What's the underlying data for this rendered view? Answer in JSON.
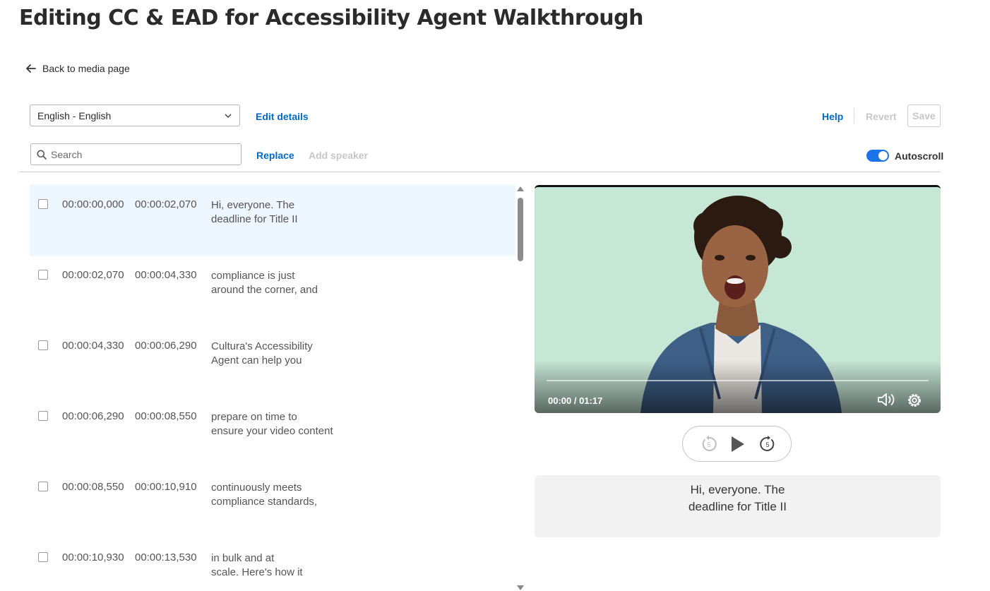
{
  "page": {
    "title": "Editing CC & EAD for Accessibility Agent Walkthrough"
  },
  "nav": {
    "back_label": "Back to media page"
  },
  "toolbar": {
    "language_selected": "English - English",
    "edit_details_label": "Edit details",
    "help_label": "Help",
    "revert_label": "Revert",
    "save_label": "Save",
    "search_placeholder": "Search",
    "replace_label": "Replace",
    "add_speaker_label": "Add speaker",
    "autoscroll_label": "Autoscroll",
    "autoscroll_on": true
  },
  "captions": [
    {
      "start": "00:00:00,000",
      "end": "00:00:02,070",
      "line1": "Hi, everyone. The",
      "line2": "deadline for Title II"
    },
    {
      "start": "00:00:02,070",
      "end": "00:00:04,330",
      "line1": "compliance is just",
      "line2": "around the corner, and"
    },
    {
      "start": "00:00:04,330",
      "end": "00:00:06,290",
      "line1": "Cultura's Accessibility",
      "line2": "Agent can help you"
    },
    {
      "start": "00:00:06,290",
      "end": "00:00:08,550",
      "line1": "prepare on time to",
      "line2": "ensure your video content"
    },
    {
      "start": "00:00:08,550",
      "end": "00:00:10,910",
      "line1": "continuously meets",
      "line2": "compliance standards,"
    },
    {
      "start": "00:00:10,930",
      "end": "00:00:13,530",
      "line1": "in bulk and at",
      "line2": "scale. Here's how it"
    }
  ],
  "player": {
    "time_display": "00:00 / 01:17",
    "rewind_seconds": "5",
    "forward_seconds": "5",
    "icons": [
      "volume-icon",
      "settings-icon",
      "rewind-5-icon",
      "play-icon",
      "forward-5-icon"
    ]
  },
  "caption_preview": {
    "line1": "Hi, everyone. The",
    "line2": "deadline for Title II"
  },
  "colors": {
    "accent": "#006acc",
    "toggle": "#1a73e8",
    "active_row": "#eef6ff",
    "disabled": "#c7c7c7"
  }
}
